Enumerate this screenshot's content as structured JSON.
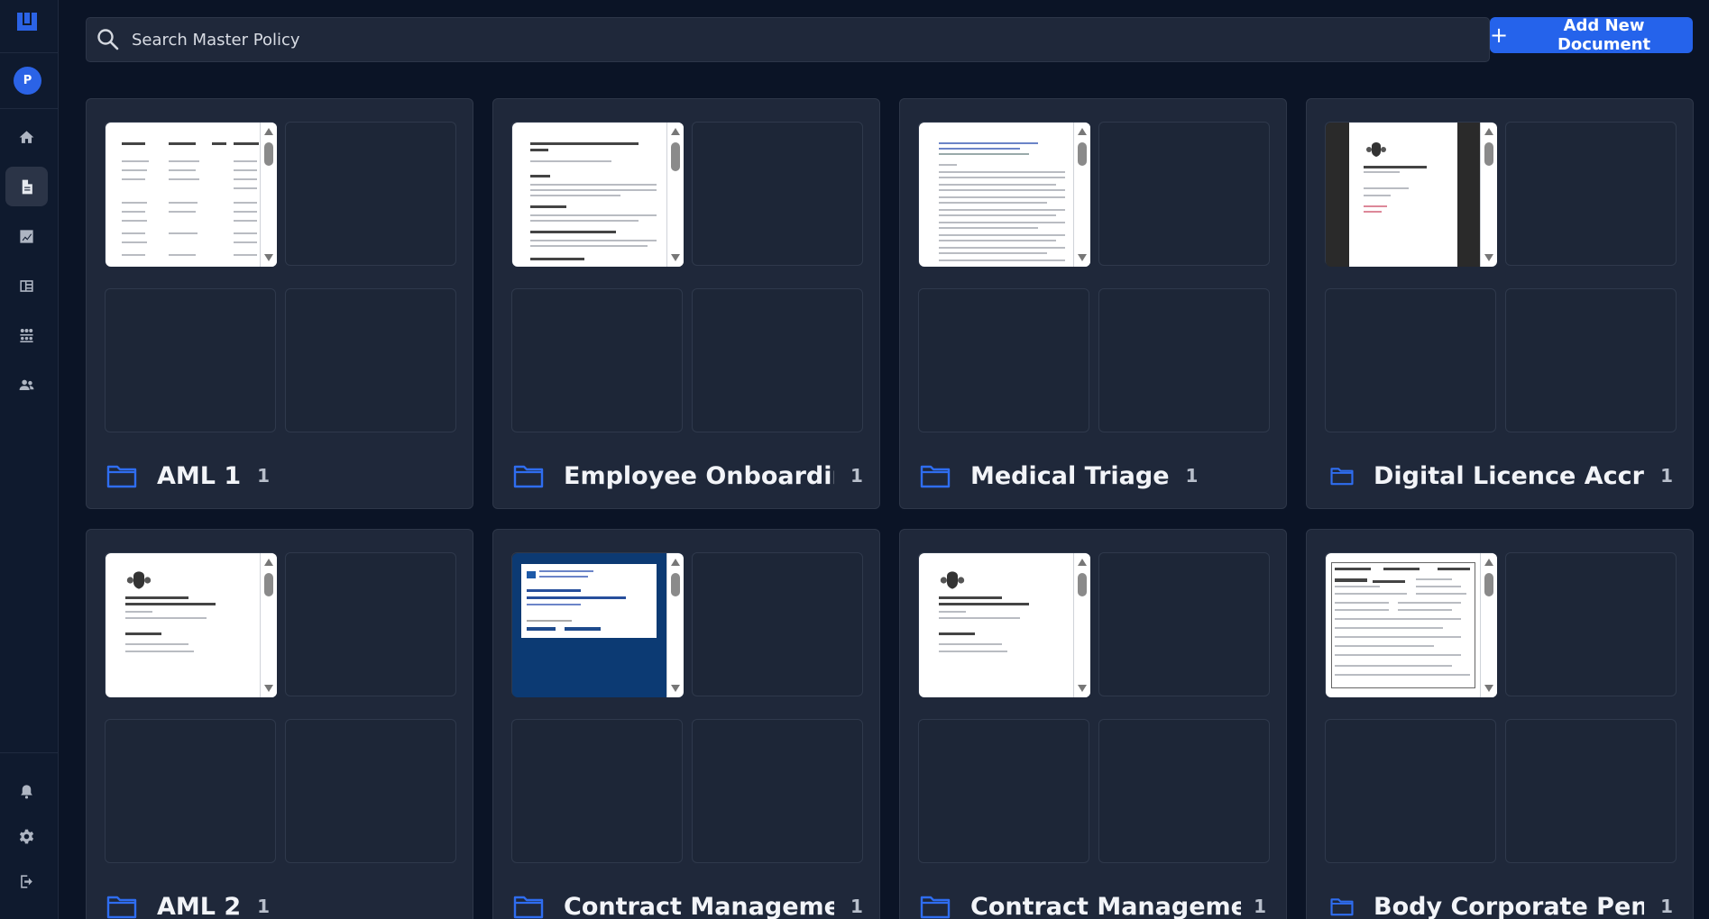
{
  "sidebar": {
    "avatar_initial": "P",
    "nav": [
      {
        "icon": "home-icon"
      },
      {
        "icon": "document-icon",
        "active": true
      },
      {
        "icon": "chart-icon"
      },
      {
        "icon": "table-icon"
      },
      {
        "icon": "org-chart-icon"
      },
      {
        "icon": "users-icon"
      }
    ],
    "bottom": [
      {
        "icon": "bell-icon"
      },
      {
        "icon": "gear-icon"
      },
      {
        "icon": "logout-icon"
      }
    ]
  },
  "search": {
    "placeholder": "Search Master Policy"
  },
  "toolbar": {
    "add_label": "Add New Document"
  },
  "cards": [
    {
      "title": "AML 1",
      "count": "1"
    },
    {
      "title": "Employee Onboarding",
      "count": "1"
    },
    {
      "title": "Medical Triage",
      "count": "1"
    },
    {
      "title": "Digital Licence Accre...",
      "count": "1"
    },
    {
      "title": "AML 2",
      "count": "1"
    },
    {
      "title": "Contract Management",
      "count": "1"
    },
    {
      "title": "Contract Manageme...",
      "count": "1"
    },
    {
      "title": "Body Corporate Penth...",
      "count": "1"
    }
  ],
  "colors": {
    "accent": "#2563eb",
    "background": "#0b1426",
    "card": "#1f283a"
  }
}
